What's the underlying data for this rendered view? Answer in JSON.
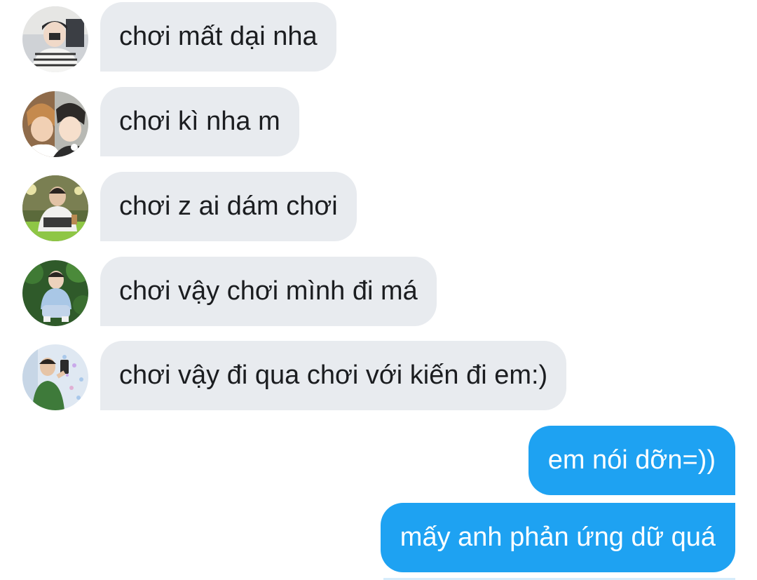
{
  "conversation": {
    "incoming": [
      {
        "text": "chơi mất dại nha",
        "avatar": "user-avatar-1"
      },
      {
        "text": "chơi kì nha m",
        "avatar": "user-avatar-2"
      },
      {
        "text": "chơi z ai dám chơi",
        "avatar": "user-avatar-3"
      },
      {
        "text": "chơi vậy chơi mình đi má",
        "avatar": "user-avatar-4"
      },
      {
        "text": "chơi vậy đi qua chơi với kiến đi em:)",
        "avatar": "user-avatar-5"
      }
    ],
    "outgoing": [
      {
        "text": "em nói dỡn=))"
      },
      {
        "text": "mấy anh phản ứng dữ quá"
      }
    ]
  },
  "colors": {
    "incoming_bubble": "#e8ebef",
    "outgoing_bubble": "#1ea2f2",
    "incoming_text": "#1b1d20",
    "outgoing_text": "#ffffff",
    "background": "#ffffff"
  }
}
